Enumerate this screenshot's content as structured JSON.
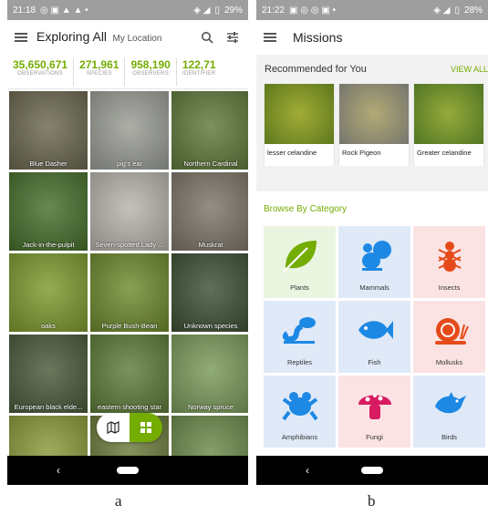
{
  "panel_a": {
    "status": {
      "time": "21:18",
      "battery": "29%"
    },
    "header": {
      "title": "Exploring All",
      "subtitle": "My Location"
    },
    "stats": [
      {
        "value": "35,650,671",
        "label": "OBSERVATIONS"
      },
      {
        "value": "271,961",
        "label": "SPECIES"
      },
      {
        "value": "958,190",
        "label": "OBSERVERS"
      },
      {
        "value": "122,71",
        "label": "IDENTIFIER"
      }
    ],
    "observations": [
      {
        "label": "Blue Dasher",
        "color": "#6b6750"
      },
      {
        "label": "pig's ear",
        "color": "#9a9d95"
      },
      {
        "label": "Northern Cardinal",
        "color": "#5f7a3a"
      },
      {
        "label": "Jack-in-the-pulpit",
        "color": "#466f2c"
      },
      {
        "label": "Seven-spotted Lady ...",
        "color": "#b8b4ac"
      },
      {
        "label": "Muskrat",
        "color": "#7d7568"
      },
      {
        "label": "oaks",
        "color": "#7d9a2e"
      },
      {
        "label": "Purple Bush-Bean",
        "color": "#6e8a2e"
      },
      {
        "label": "Unknown species",
        "color": "#3e5035"
      },
      {
        "label": "European black elde...",
        "color": "#4a5a3a"
      },
      {
        "label": "eastern shooting star",
        "color": "#5e7c3a"
      },
      {
        "label": "Norway spruce",
        "color": "#7a9a5a"
      },
      {
        "label": "",
        "color": "#8a9a3a"
      },
      {
        "label": "",
        "color": "#6a7a3a"
      },
      {
        "label": "",
        "color": "#6a8a4a"
      }
    ],
    "panel_label": "a"
  },
  "panel_b": {
    "status": {
      "time": "21:22",
      "battery": "28%"
    },
    "header": {
      "title": "Missions"
    },
    "recommended": {
      "title": "Recommended for You",
      "view_all": "VIEW ALL",
      "cards": [
        {
          "name": "lesser celandine",
          "color": "#6f8d22"
        },
        {
          "name": "Rock Pigeon",
          "color": "#8a8a82"
        },
        {
          "name": "Greater celandine",
          "color": "#5e8a2a"
        }
      ]
    },
    "browse": {
      "title": "Browse By Category",
      "categories": [
        {
          "name": "Plants",
          "bg": "#eaf5e0",
          "fg": "#74ac00",
          "icon": "leaf-icon"
        },
        {
          "name": "Mammals",
          "bg": "#dfe9f7",
          "fg": "#1e88e5",
          "icon": "squirrel-icon"
        },
        {
          "name": "Insects",
          "bg": "#fbe3e3",
          "fg": "#e64a19",
          "icon": "ant-icon"
        },
        {
          "name": "Reptiles",
          "bg": "#dfe9f7",
          "fg": "#1e88e5",
          "icon": "lizard-icon"
        },
        {
          "name": "Fish",
          "bg": "#dfe9f7",
          "fg": "#1e88e5",
          "icon": "fish-icon"
        },
        {
          "name": "Mollusks",
          "bg": "#fbe3e3",
          "fg": "#e64a19",
          "icon": "snail-icon"
        },
        {
          "name": "Amphibians",
          "bg": "#dfe9f7",
          "fg": "#1e88e5",
          "icon": "frog-icon"
        },
        {
          "name": "Fungi",
          "bg": "#fbe3e3",
          "fg": "#d81b60",
          "icon": "mushroom-icon"
        },
        {
          "name": "Birds",
          "bg": "#dfe9f7",
          "fg": "#1e88e5",
          "icon": "bird-icon"
        }
      ]
    },
    "panel_label": "b"
  }
}
